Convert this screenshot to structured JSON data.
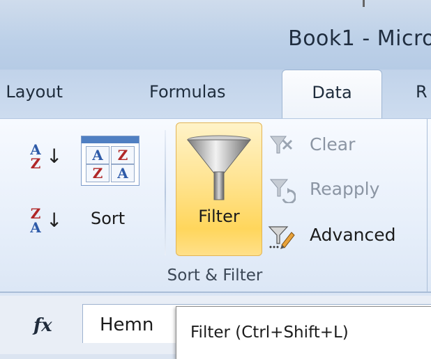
{
  "window": {
    "title": "Book1 - Micro"
  },
  "tabs": {
    "page_layout": "e Layout",
    "formulas": "Formulas",
    "data": "Data",
    "next": "R"
  },
  "ribbon": {
    "sort_filter_group": {
      "label": "Sort & Filter",
      "sort_az": {
        "letters_top": "A",
        "letters_bottom": "Z",
        "arrow": "↓"
      },
      "sort_za": {
        "letters_top": "Z",
        "letters_bottom": "A",
        "arrow": "↓"
      },
      "sort_label": "Sort",
      "sort_icon": {
        "top_left": "A",
        "top_right": "Z",
        "bottom_left": "Z",
        "bottom_right": "A"
      },
      "filter_label": "Filter",
      "clear_label": "Clear",
      "reapply_label": "Reapply",
      "advanced_label": "Advanced"
    }
  },
  "formula_bar": {
    "fx_symbol": "fx",
    "cell_value": "Hemn"
  },
  "tooltip": {
    "text": "Filter (Ctrl+Shift+L)"
  },
  "colors": {
    "filter_highlight": "#ffd65c",
    "accent_blue": "#2d5aa8",
    "accent_red": "#b02727"
  }
}
